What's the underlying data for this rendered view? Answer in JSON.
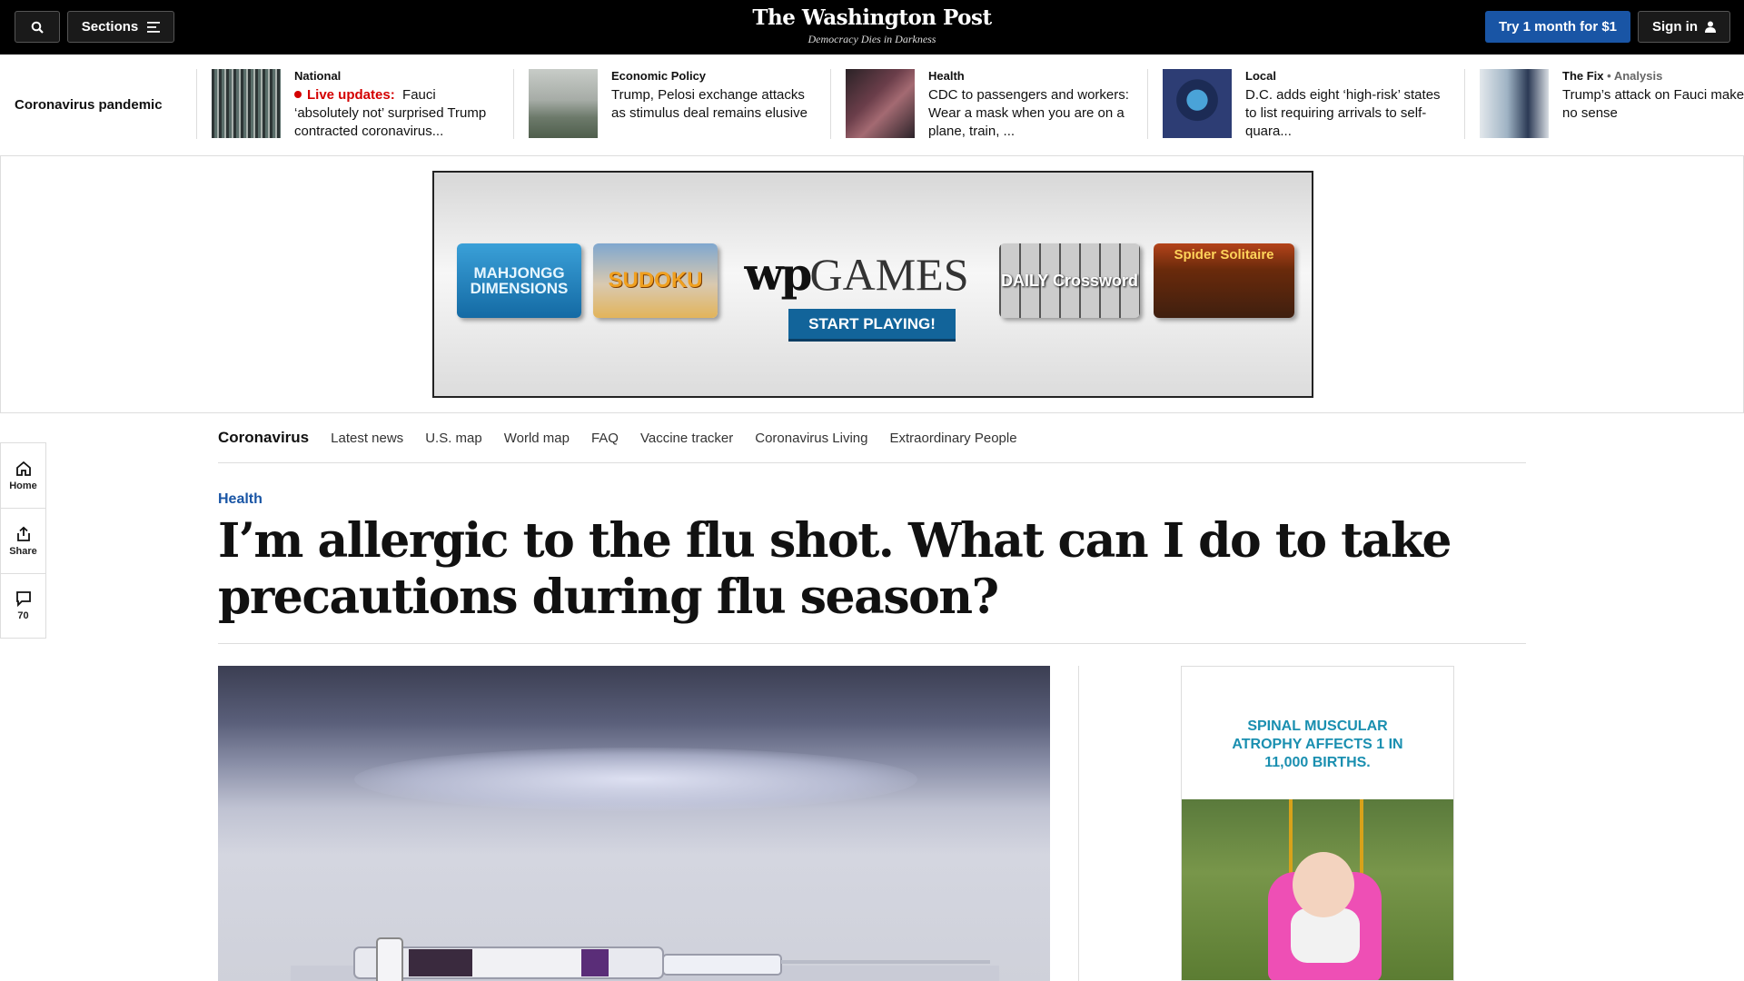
{
  "topbar": {
    "sections_label": "Sections",
    "logo": "The Washington Post",
    "tagline": "Democracy Dies in Darkness",
    "try_label": "Try 1 month for $1",
    "signin_label": "Sign in",
    "accent_color": "#1955a5"
  },
  "strip": {
    "title": "Coronavirus pandemic",
    "items": [
      {
        "kicker": "National",
        "live_label": "Live updates:",
        "headline": "Fauci ‘absolutely not’ surprised Trump contracted coronavirus..."
      },
      {
        "kicker": "Economic Policy",
        "headline": "Trump, Pelosi exchange attacks as stimulus deal remains elusive"
      },
      {
        "kicker": "Health",
        "headline": "CDC to passengers and workers: Wear a mask when you are on a plane, train, ..."
      },
      {
        "kicker": "Local",
        "headline": "D.C. adds eight ‘high-risk’ states to list requiring arrivals to self-quara..."
      },
      {
        "kicker": "The Fix",
        "kicker_extra": "• Analysis",
        "headline": "Trump’s attack on Fauci makes no sense"
      }
    ]
  },
  "ad": {
    "games": [
      "MAHJONGG DIMENSIONS",
      "SUDOKU",
      "DAILY Crossword",
      "Spider Solitaire"
    ],
    "brand_wp": "wp",
    "brand_games": "GAMES",
    "cta": "START PLAYING!"
  },
  "rail": {
    "home": "Home",
    "share": "Share",
    "comments": "70"
  },
  "secnav": {
    "home": "Coronavirus",
    "links": [
      "Latest news",
      "U.S. map",
      "World map",
      "FAQ",
      "Vaccine tracker",
      "Coronavirus Living",
      "Extraordinary People"
    ]
  },
  "article": {
    "kicker": "Health",
    "title": "I’m allergic to the flu shot. What can I do to take precautions during flu season?"
  },
  "sidead": {
    "text": "SPINAL MUSCULAR ATROPHY AFFECTS 1 IN 11,000 BIRTHS."
  }
}
